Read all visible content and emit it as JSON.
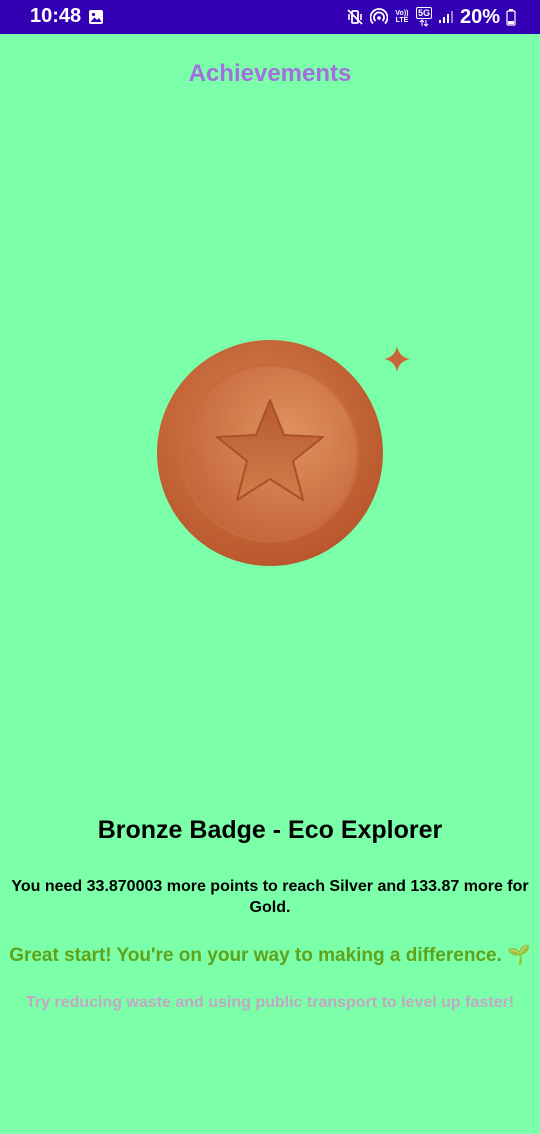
{
  "status_bar": {
    "time": "10:48",
    "battery_text": "20%",
    "volte_label": "Vo)) LTE",
    "network_label": "5G",
    "icons": [
      "gallery-icon",
      "vibrate-icon",
      "hotspot-icon",
      "volte-icon",
      "network-5g-icon",
      "signal-icon",
      "battery-icon"
    ]
  },
  "header": {
    "title": "Achievements"
  },
  "badge": {
    "title": "Bronze Badge - Eco Explorer",
    "points_message": "You need 33.870003 more points to reach Silver and 133.87 more for Gold.",
    "encouragement": "Great start! You're on your way to making a difference. 🌱",
    "tip": "Try reducing waste and using public transport to level up faster!",
    "medal_icon": "bronze-medal-star-icon",
    "sparkle_icon": "sparkle-icon"
  },
  "colors": {
    "background": "#7bffa8",
    "status_bar": "#3300b3",
    "title": "#a56ee0",
    "bronze": "#c8663a",
    "encouragement": "#5fa31a",
    "tip": "#c3a8c3"
  }
}
